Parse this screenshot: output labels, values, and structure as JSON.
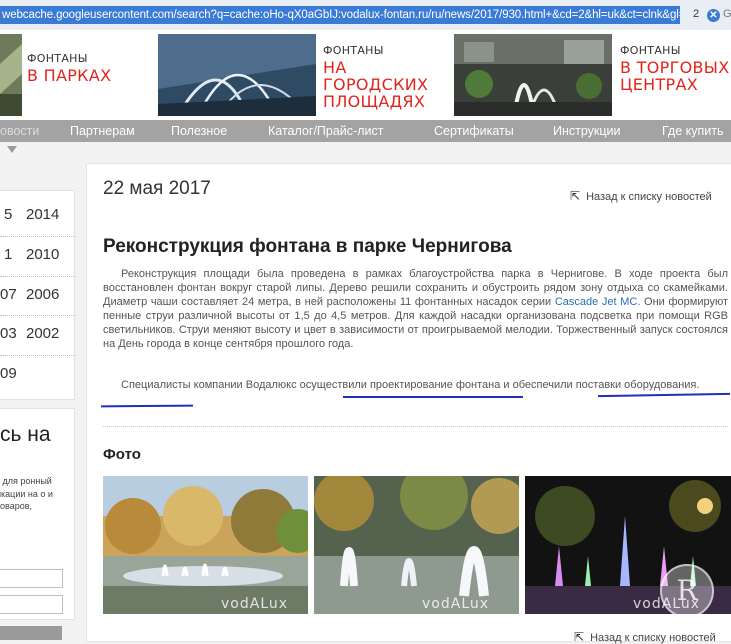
{
  "browser": {
    "url": "webcache.googleusercontent.com/search?q=cache:oHo-qX0aGbIJ:vodalux-fontan.ru/ru/news/2017/930.html+&cd=2&hl=uk&ct=clnk&gl=ru",
    "count": "2",
    "close_glyph": "✕",
    "next_glyph": "G"
  },
  "banner": [
    {
      "small": "ФОНТАНЫ",
      "big": "В ПАРКАХ"
    },
    {
      "small": "ФОНТАНЫ",
      "big": "НА ГОРОДСКИХ ПЛОЩАДЯХ"
    },
    {
      "small": "ФОНТАНЫ",
      "big": "В ТОРГОВЫХ ЦЕНТРАХ"
    }
  ],
  "nav": [
    "овости",
    "Партнерам",
    "Полезное",
    "Каталог/Прайс-лист",
    "Сертификаты",
    "Инструкции",
    "Где купить"
  ],
  "sidebar": {
    "years_left": [
      "5",
      "1",
      "07",
      "03",
      "09"
    ],
    "years_right": [
      "2014",
      "2010",
      "2006",
      "2002"
    ],
    "signup_title": "сь на",
    "signup_text": "ii для ронный икации на о и товаров,"
  },
  "article": {
    "date": "22 мая 2017",
    "back_label": "Назад к списку новостей",
    "title": "Реконструкция фонтана в парке Чернигова",
    "p1_a": "Реконструкция площади была проведена в рамках благоустройства парка в Чернигове. В ходе проекта был восстановлен фонтан вокруг старой липы. Дерево решили сохранить и обустроить рядом зону отдыха со скамейками. Диаметр чаши составляет 24 метра, в ней расположены 11 фонтанных насадок серии ",
    "p1_link": "Cascade Jet MC",
    "p1_b": ". Они формируют пенные струи различной высоты от 1,5 до 4,5 метров. Для каждой насадки организована подсветка при помощи RGB светильников. Струи меняют высоту и цвет в зависимости от проигрываемой мелодии. Торжественный запуск состоялся на День города в конце сентября прошлого года.",
    "p2": "Специалисты компании Водалюкс осуществили проектирование фонтана и обеспечили поставки оборудования.",
    "photo_heading": "Фото",
    "watermark": "vodALux",
    "back_bottom_label": "Назад к списку новостей"
  },
  "colors": {
    "accent_red": "#e2241b",
    "nav_gray": "#a3a3a3",
    "link_blue": "#2a6fb5",
    "annotation_blue": "#1e2fb8"
  }
}
